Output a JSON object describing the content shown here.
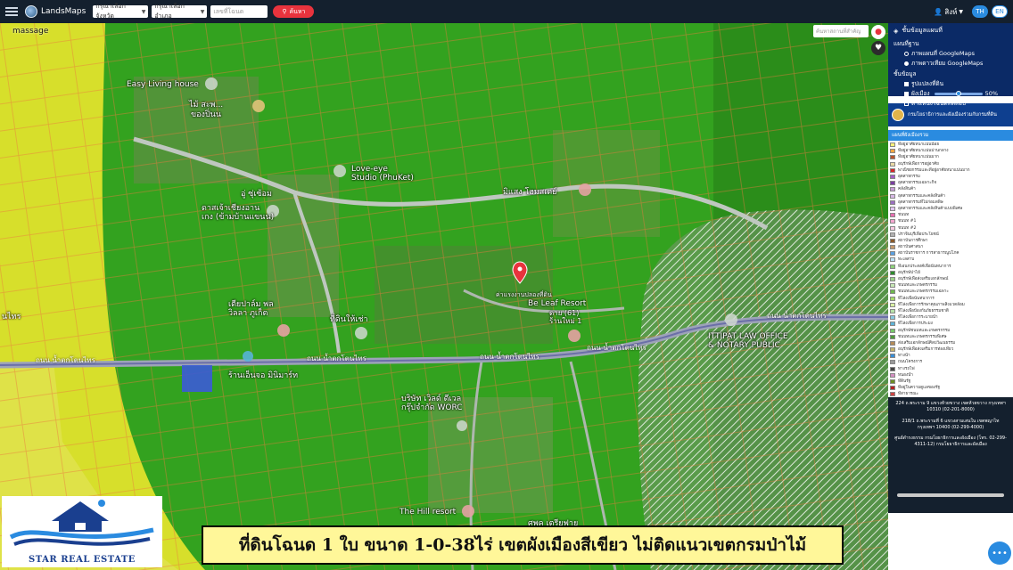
{
  "app": {
    "brand": "LandsMaps",
    "province_select": "กรุณาเลือกจังหวัด",
    "district_select": "กรุณาเลือกอำเภอ",
    "deed_placeholder": "เลขที่โฉนด",
    "search_label": "ค้นหา",
    "user": "สิงห์",
    "lang_th": "TH",
    "lang_en": "EN"
  },
  "map": {
    "search_placeholder": "ค้นหาสถานที่สำคัญ",
    "labels": {
      "massage": "massage",
      "easy_living": "Easy Living house",
      "saphan": "ไม้ สะพ...",
      "songpinong": "ของปิ่นน",
      "love_eye": "Love-eye\nStudio (PhuKet)",
      "seua": "อู่ ซุ่เซ้อม",
      "kasem": "ดาสเจ้าเชียงอาน\nเกง (ข้ามบ้านแขนน)",
      "misaeng": "มิแสง โฮมสเตย์",
      "plot": "ค่าแรงงานปลองที่ดิน",
      "be_leaf": "Be Leaf Resort",
      "tiplang": "ดาย (61)\nร้านใหม่ 1",
      "pink_phuket": "เตียปาล์ม พล\nวิลลา ภูเก็ต",
      "thinvai": "ที่ดินให้เช่า",
      "ittipat": "ITTIPAT LAW OFFICE\n& NOTARY PUBLIC",
      "rannhong": "ร้านเอ็นจอ มินิมาร์ท",
      "company": "บริษัท เวิลด์ ดีเวล\nกรุ๊ปจำกัด WORC",
      "hill_resort": "The Hill resort",
      "jeng": "ศพค เตรียฟาย",
      "road_left": "ถนน น้ำตกโตนไทร",
      "road_mid": "ถนน น้ำตกโตนไทร",
      "road_mid2": "ถนน น้ำตกโตนไทร",
      "road_right": "ถนน น้ำตกโตนไทร",
      "road_right2": "ถนน น้ำตกโตนไทร",
      "tone_sai": "นไทร"
    }
  },
  "panel": {
    "title": "ชั้นข้อมูลแผนที่",
    "basemap_heading": "แผนที่ฐาน",
    "basemap_options": [
      {
        "label": "ภาพแผนที่ GoogleMaps",
        "selected": false
      },
      {
        "label": "ภาพดาวเทียม GoogleMaps",
        "selected": true
      }
    ],
    "layers_heading": "ชั้นข้อมูล",
    "layers": [
      {
        "label": "รูปแปลงที่ดิน",
        "checked": true
      },
      {
        "label": "ผังเมือง",
        "checked": true,
        "opacity_label": "50%",
        "opacity": 0.5
      },
      {
        "label": "ตำแหน่งโฉนดทดสอบ",
        "checked": false
      }
    ],
    "org_name": "กรมโยธาธิการและผังเมืองร่วมกับกรมที่ดิน",
    "legend_heading": "แผนที่ผังเมืองรวม",
    "legend": [
      {
        "label": "ที่อยู่อาศัยหนาแน่นน้อย",
        "color": "#f7f17a"
      },
      {
        "label": "ที่อยู่อาศัยหนาแน่นปานกลาง",
        "color": "#f2a541"
      },
      {
        "label": "ที่อยู่อาศัยหนาแน่นมาก",
        "color": "#b5562e"
      },
      {
        "label": "อนุรักษ์เพื่อการอยู่อาศัย",
        "color": "#e8d9a5"
      },
      {
        "label": "พาณิชยกรรมและที่อยู่อาศัยหนาแน่นมาก",
        "color": "#d62828"
      },
      {
        "label": "อุตสาหกรรม",
        "color": "#a45fc4"
      },
      {
        "label": "อุตสาหกรรมเฉพาะกิจ",
        "color": "#7b3fa0"
      },
      {
        "label": "คลังสินค้า",
        "color": "#c79bd6"
      },
      {
        "label": "อุตสาหกรรมและคลังสินค้า",
        "color": "#d7b8e6"
      },
      {
        "label": "อุตสาหกรรมที่ไม่ก่อมลพิษ",
        "color": "#9b6fc1"
      },
      {
        "label": "อุตสาหกรรมและคลังสินค้าแบบพิเศษ",
        "color": "#e0c4ef"
      },
      {
        "label": "ชนบท",
        "color": "#e66fb0"
      },
      {
        "label": "ชนบท #1",
        "color": "#f4a6cf"
      },
      {
        "label": "ชนบท #2",
        "color": "#f9cbe2"
      },
      {
        "label": "ปราจีนบุรีเพื่อประโยชน์",
        "color": "#b0b0b0"
      },
      {
        "label": "สถาบันการศึกษา",
        "color": "#8a5a2a"
      },
      {
        "label": "สถาบันศาสนา",
        "color": "#c49a6c"
      },
      {
        "label": "สถาบันราชการ การสาธารณูปโภค",
        "color": "#5aa0e0"
      },
      {
        "label": "ทะเลสาบ",
        "color": "#bfe3f7"
      },
      {
        "label": "ที่เอนกประสงค์เพื่อนันทนาการ",
        "color": "#8ed17a"
      },
      {
        "label": "อนุรักษ์ป่าไม้",
        "color": "#2e8b2e"
      },
      {
        "label": "อนุรักษ์เพื่อส่งเสริมเอกลักษณ์",
        "color": "#9bd18a"
      },
      {
        "label": "ชนบทและเกษตรกรรม",
        "color": "#c7e8b5"
      },
      {
        "label": "ชนบทและเกษตรกรรมเฉพาะ",
        "color": "#6fb84f"
      },
      {
        "label": "ที่โล่งเพื่อนันทนาการ",
        "color": "#a6d96a"
      },
      {
        "label": "ที่โล่งเพื่อการรักษาคุณภาพสิ่งแวดล้อม",
        "color": "#d9f0a3"
      },
      {
        "label": "ที่โล่งเพื่อป้องกันภัยธรรมชาติ",
        "color": "#b7e2a8"
      },
      {
        "label": "ที่โล่งเพื่อการระบายน้ำ",
        "color": "#88c9e0"
      },
      {
        "label": "ที่โล่งเพื่อการประมง",
        "color": "#5fb3d6"
      },
      {
        "label": "อนุรักษ์ชนบทและเกษตรกรรม",
        "color": "#78c66a"
      },
      {
        "label": "ชนบทและเกษตรกรรมพิเศษ",
        "color": "#4f9a3c"
      },
      {
        "label": "ส่งเสริมเอกลักษณ์ศิลปวัฒนธรรม",
        "color": "#b38b58"
      },
      {
        "label": "อนุรักษ์เพื่อส่งเสริมการท่องเที่ยว",
        "color": "#c5b36a"
      },
      {
        "label": "ทางน้ำ",
        "color": "#3a8fd6"
      },
      {
        "label": "ถนนโครงการ",
        "color": "#999999"
      },
      {
        "label": "ทางรถไฟ",
        "color": "#444444"
      },
      {
        "label": "หนองน้ำ",
        "color": "#d38fc2"
      },
      {
        "label": "ที่ดินรัฐ",
        "color": "#6b8e23"
      },
      {
        "label": "ที่อยู่ในความดูแลของรัฐ",
        "color": "#b22222"
      },
      {
        "label": "ที่สาธารณะ",
        "color": "#cc4444"
      }
    ],
    "footer": [
      "224 ถ.พระราม 9 แขวงห้วยขวาง เขตห้วยขวาง กรุงเทพฯ 10310 (02-201-8000)",
      "218/1 ถ.พระรามที่ 6 แขวงสามเสนใน เขตพญาไท กรุงเทพฯ 10400 (02-299-4000)",
      "ศูนย์ดำรงธรรม กรมโยธาธิการและผังเมือง (โทร. 02-299-4311-12) กรมโยธาธิการและผังเมือง"
    ]
  },
  "overlay": {
    "brand_name": "STAR REAL ESTATE",
    "caption": "ที่ดินโฉนด 1 ใบ ขนาด 1-0-38ไร่  เขตผังเมืองสีเขียว ไม่ติดแนวเขตกรมป่าไม้"
  },
  "colors": {
    "topbar": "#14202e",
    "panel_head": "#0b2a66",
    "zone_green": "#2f9a1f",
    "zone_yellow": "#d9e02a",
    "caption_bg": "#fff799",
    "search_button": "#e8333d",
    "accent": "#2a8be0"
  },
  "icons": {
    "menu": "hamburger-icon",
    "search": "search-icon",
    "user": "user-icon",
    "pin": "map-pin-icon",
    "favorite": "heart-icon",
    "chat": "chat-icon"
  }
}
